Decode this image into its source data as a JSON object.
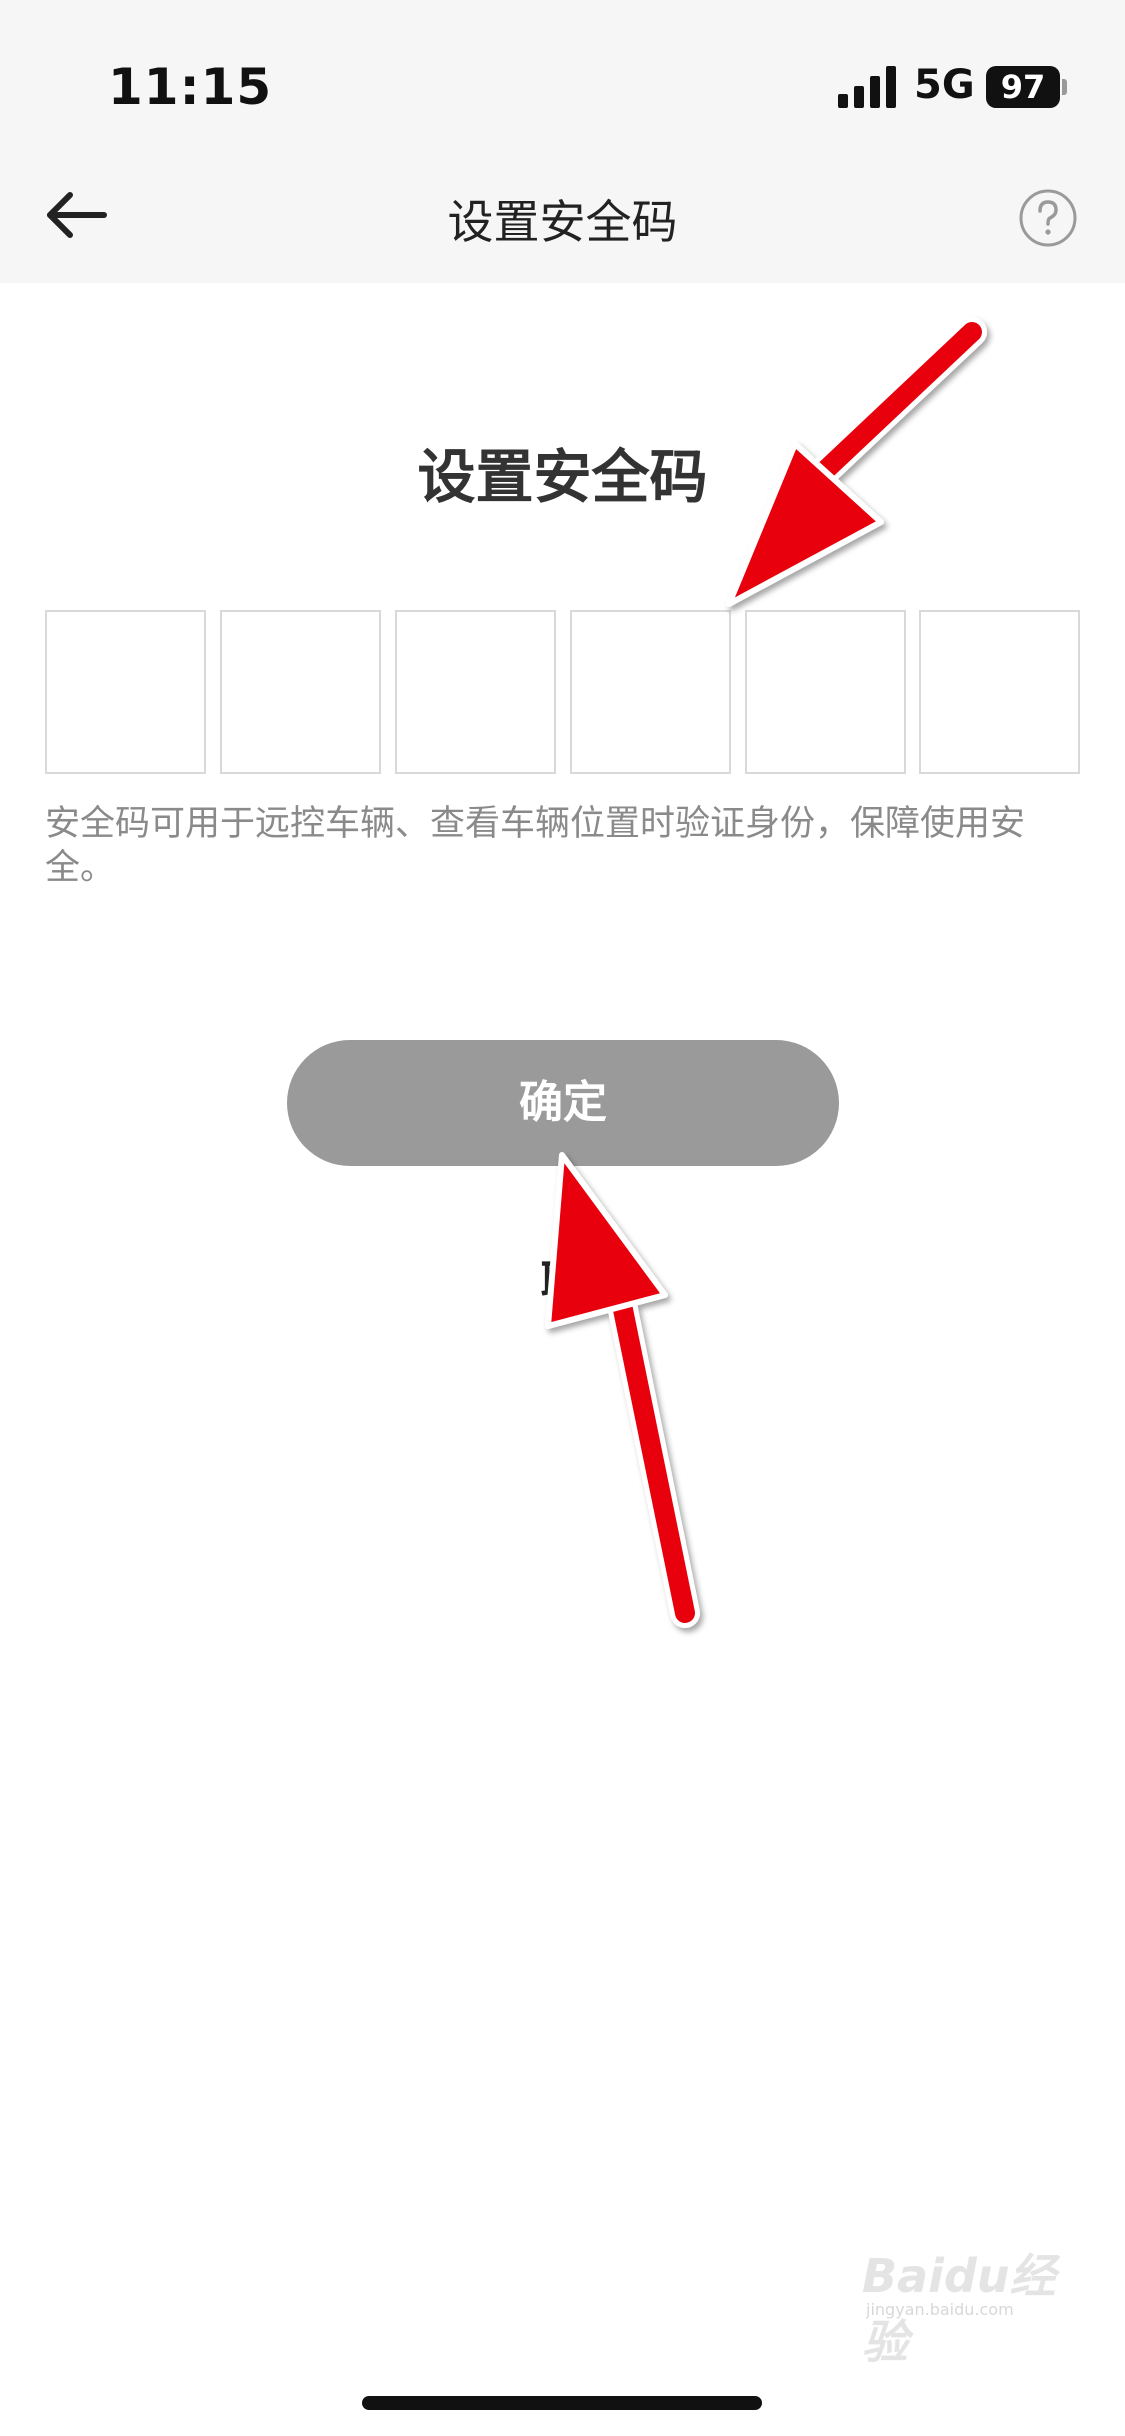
{
  "status_bar": {
    "time": "11:15",
    "network": "5G",
    "battery": "97",
    "icons": [
      "signal-icon",
      "battery-icon"
    ]
  },
  "nav": {
    "title": "设置安全码",
    "back_icon": "back-arrow-icon",
    "help_icon": "help-icon"
  },
  "main": {
    "heading": "设置安全码",
    "code_boxes": [
      "",
      "",
      "",
      "",
      "",
      ""
    ],
    "hint": "安全码可用于远控车辆、查看车辆位置时验证身份，保障使用安全。",
    "confirm_label": "确定",
    "cancel_label": "取"
  },
  "annotation": {
    "color": "#e8000b",
    "arrows": [
      "arrow pointing to code boxes",
      "arrow pointing to confirm button"
    ]
  },
  "watermark": {
    "text": "Baidu经验",
    "sub": "jingyan.baidu.com"
  },
  "colors": {
    "top_bg": "#f6f6f6",
    "button_disabled": "#9a9a9a",
    "box_border": "#d9d9d9",
    "hint_text": "#8a8a8a"
  }
}
